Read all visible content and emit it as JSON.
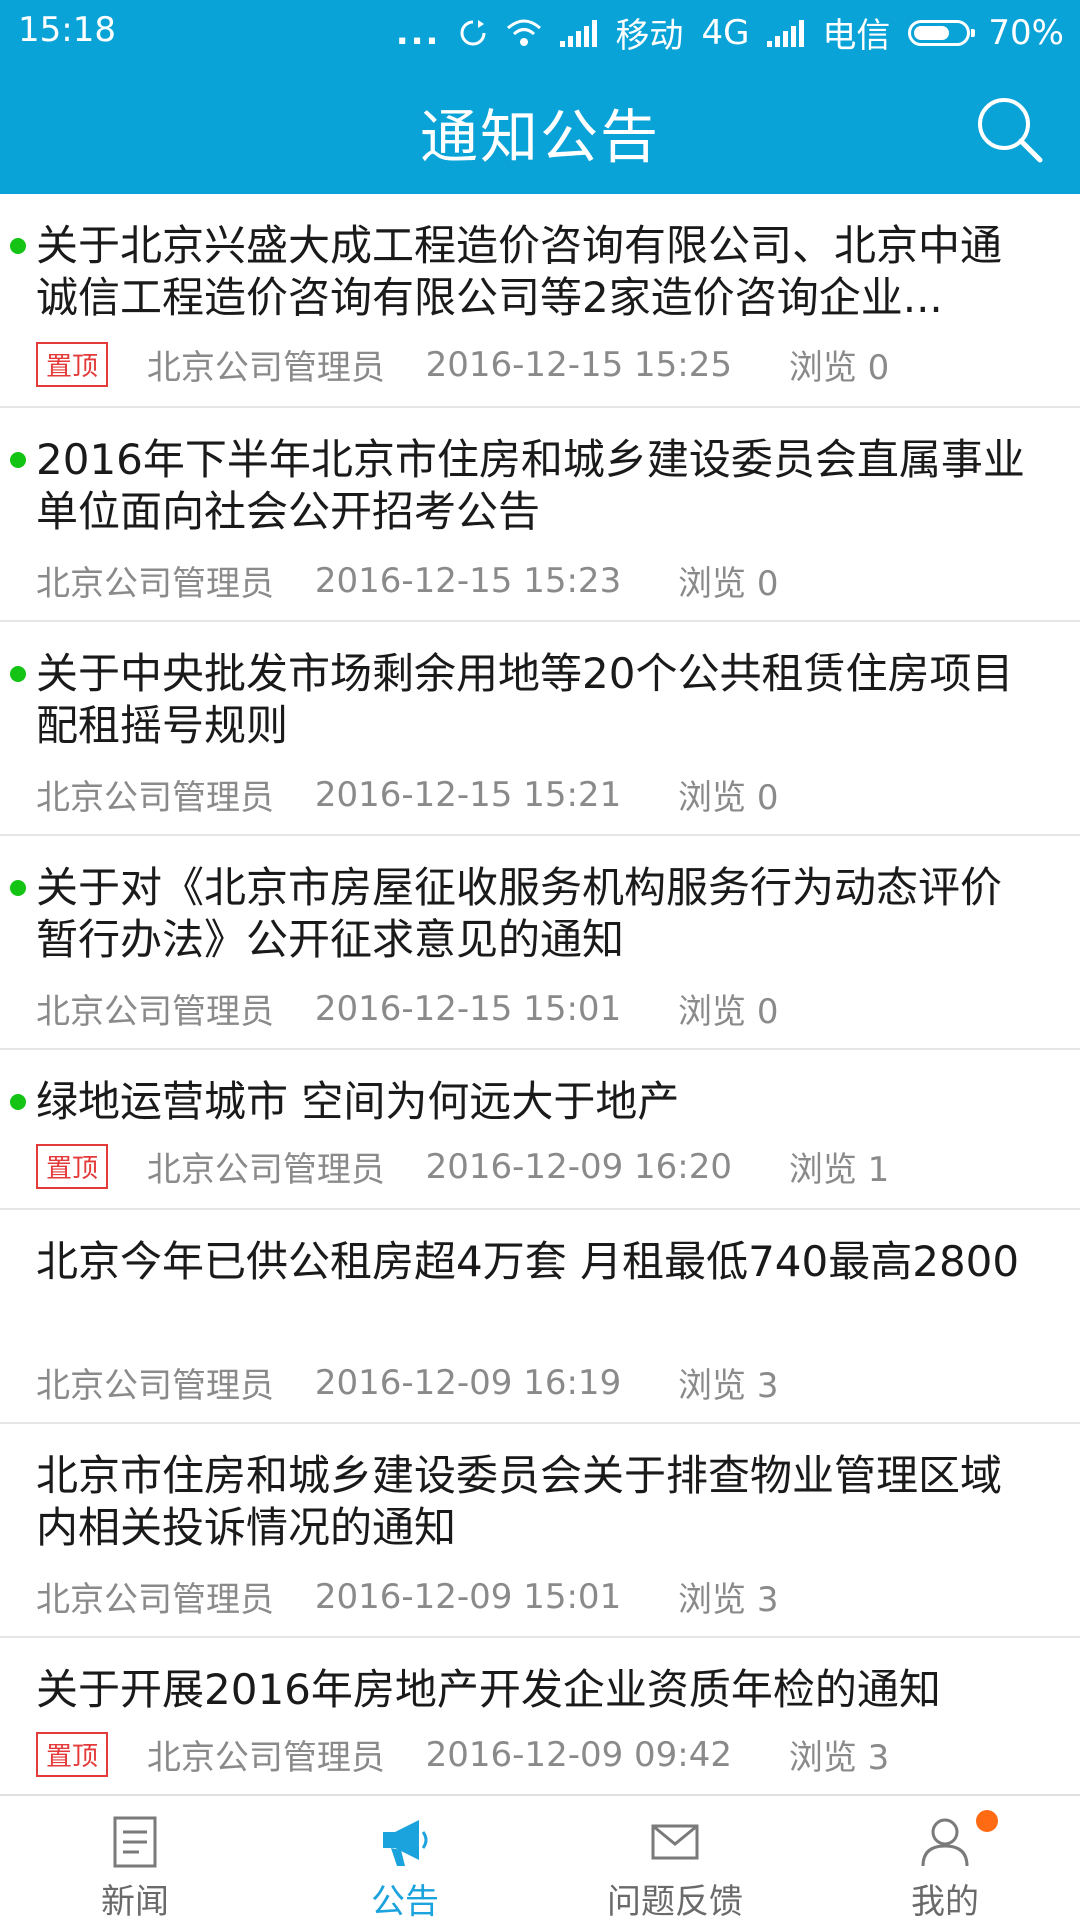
{
  "status_bar": {
    "time": "15:18",
    "dots": "...",
    "carrier1": "移动",
    "network": "4G",
    "carrier2": "电信",
    "battery": "70%",
    "battery_level": 0.7
  },
  "header": {
    "title": "通知公告"
  },
  "list": {
    "items": [
      {
        "title": "关于北京兴盛大成工程造价咨询有限公司、北京中通诚信工程造价咨询有限公司等2家造价咨询企业...",
        "pinned": true,
        "badge": "置顶",
        "author": "北京公司管理员",
        "datetime": "2016-12-15 15:25",
        "views": "浏览 0",
        "unread": true
      },
      {
        "title": "2016年下半年北京市住房和城乡建设委员会直属事业单位面向社会公开招考公告",
        "pinned": false,
        "badge": "",
        "author": "北京公司管理员",
        "datetime": "2016-12-15 15:23",
        "views": "浏览 0",
        "unread": true
      },
      {
        "title": "关于中央批发市场剩余用地等20个公共租赁住房项目配租摇号规则",
        "pinned": false,
        "badge": "",
        "author": "北京公司管理员",
        "datetime": "2016-12-15 15:21",
        "views": "浏览 0",
        "unread": true
      },
      {
        "title": "关于对《北京市房屋征收服务机构服务行为动态评价暂行办法》公开征求意见的通知",
        "pinned": false,
        "badge": "",
        "author": "北京公司管理员",
        "datetime": "2016-12-15 15:01",
        "views": "浏览 0",
        "unread": true
      },
      {
        "title": "绿地运营城市 空间为何远大于地产",
        "pinned": true,
        "badge": "置顶",
        "author": "北京公司管理员",
        "datetime": "2016-12-09 16:20",
        "views": "浏览 1",
        "unread": true
      },
      {
        "title": "北京今年已供公租房超4万套 月租最低740最高2800",
        "pinned": false,
        "badge": "",
        "author": "北京公司管理员",
        "datetime": "2016-12-09 16:19",
        "views": "浏览 3",
        "unread": false
      },
      {
        "title": "北京市住房和城乡建设委员会关于排查物业管理区域内相关投诉情况的通知",
        "pinned": false,
        "badge": "",
        "author": "北京公司管理员",
        "datetime": "2016-12-09 15:01",
        "views": "浏览 3",
        "unread": false
      },
      {
        "title": "关于开展2016年房地产开发企业资质年检的通知",
        "pinned": true,
        "badge": "置顶",
        "author": "北京公司管理员",
        "datetime": "2016-12-09 09:42",
        "views": "浏览 3",
        "unread": false
      }
    ]
  },
  "tabbar": {
    "tabs": [
      {
        "label": "新闻",
        "icon": "news-icon",
        "active": false
      },
      {
        "label": "公告",
        "icon": "megaphone-icon",
        "active": true
      },
      {
        "label": "问题反馈",
        "icon": "mail-icon",
        "active": false
      },
      {
        "label": "我的",
        "icon": "user-icon",
        "active": false,
        "has_dot": true
      }
    ]
  },
  "colors": {
    "primary": "#0aa3d8",
    "active_tab": "#1ba3de",
    "unread_dot": "#14c414",
    "badge": "#e43a3a",
    "notification": "#ff6a13"
  }
}
